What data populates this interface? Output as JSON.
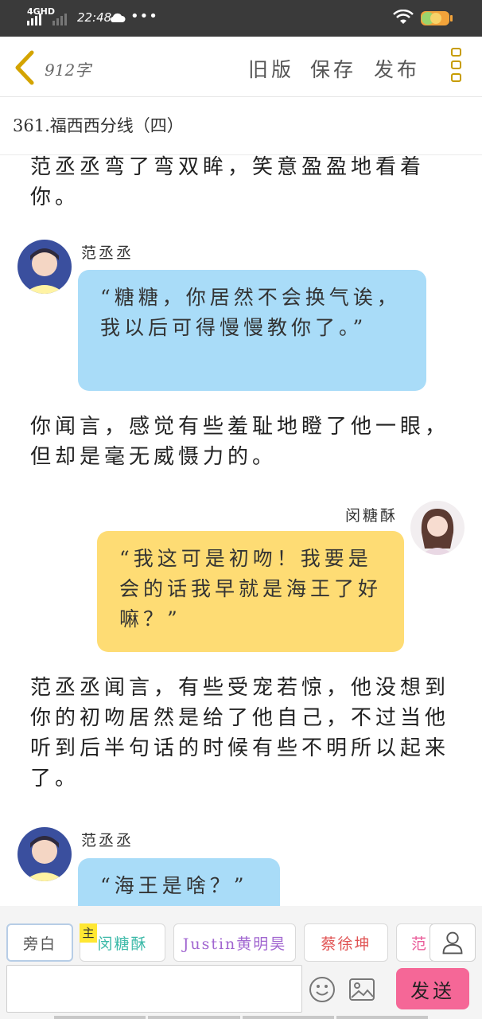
{
  "status_bar": {
    "network": "4GHD",
    "time": "22:48",
    "overflow": "•••",
    "icons": [
      "signal-icon",
      "cloud-icon",
      "wifi-icon",
      "battery-icon"
    ]
  },
  "toolbar": {
    "word_count": "912字",
    "actions": [
      "旧版",
      "保存",
      "发布"
    ],
    "menu_icon": "menu-icon"
  },
  "chapter": {
    "title": "361.福西西分线（四）"
  },
  "messages": [
    {
      "type": "narration",
      "text": "范丞丞弯了弯双眸，笑意盈盈地看着你。"
    },
    {
      "type": "dialogue",
      "speaker": "范丞丞",
      "side": "left",
      "color": "#a9dcf8",
      "text": "“糖糖，你居然不会换气诶，我以后可得慢慢教你了。”"
    },
    {
      "type": "narration",
      "text": "你闻言，感觉有些羞耻地瞪了他一眼，但却是毫无威慑力的。"
    },
    {
      "type": "dialogue",
      "speaker": "闵糖酥",
      "side": "right",
      "color": "#fedc74",
      "text": "“我这可是初吻！我要是会的话我早就是海王了好嘛？”"
    },
    {
      "type": "narration",
      "text": "范丞丞闻言，有些受宠若惊，他没想到你的初吻居然是给了他自己，不过当他听到后半句话的时候有些不明所以起来了。"
    },
    {
      "type": "dialogue",
      "speaker": "范丞丞",
      "side": "left",
      "color": "#a9dcf8",
      "text": "“海王是啥？”"
    }
  ],
  "roles": {
    "narrator": "旁白",
    "main_tag": "主",
    "main": "闵糖酥",
    "justin": "Justin黄明昊",
    "cai": "蔡徐坤",
    "fan": "范"
  },
  "input": {
    "placeholder": "",
    "send_label": "发送",
    "icons": [
      "emoji-icon",
      "image-icon",
      "user-icon"
    ]
  },
  "colors": {
    "accent_send": "#f56797",
    "bubble_left": "#a9dcf8",
    "bubble_right": "#fedc74",
    "status_bar": "#3a3a3a",
    "menu_icon": "#c79c00"
  }
}
